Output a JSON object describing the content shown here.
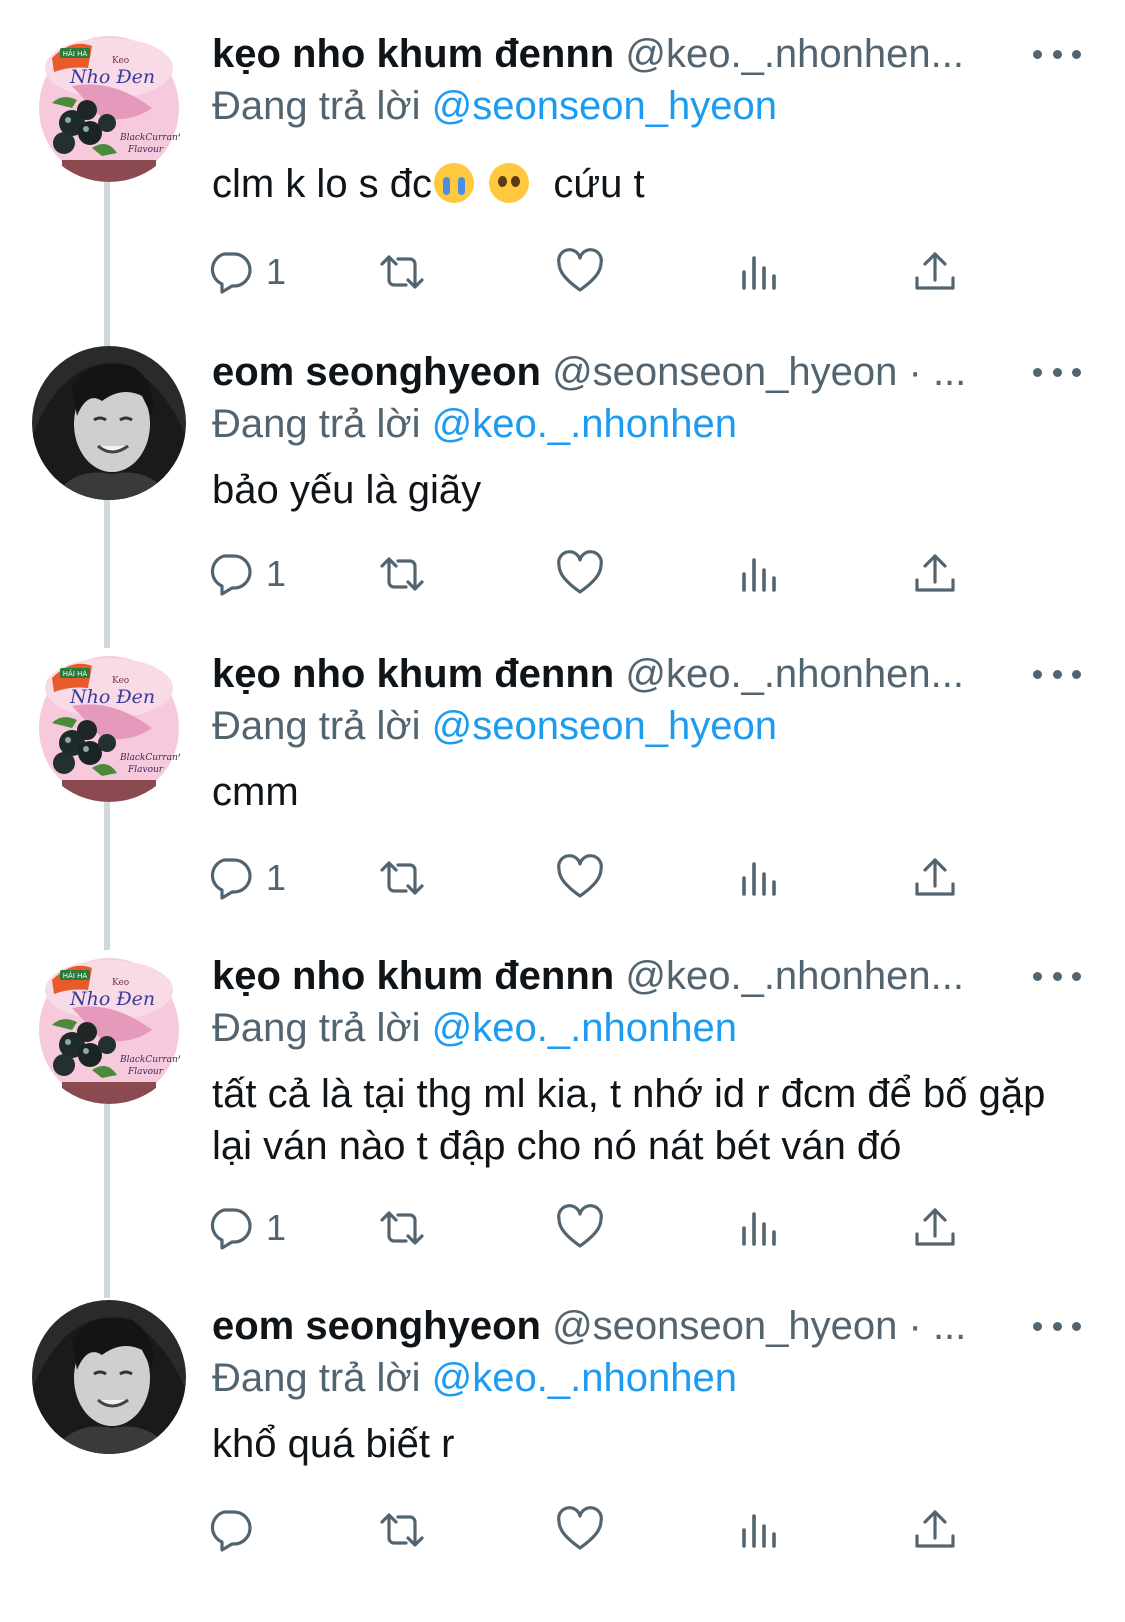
{
  "tweets": [
    {
      "name": "kẹo nho khum đennn",
      "handle": "@keo._.nhonhen...",
      "reply_prefix": "Đang trả lời",
      "reply_to": "@seonseon_hyeon",
      "text_before": "clm k lo s đc",
      "text_after": "  cứu t",
      "reply_count": "1",
      "avatar": "candy-package-avatar"
    },
    {
      "name": "eom seonghyeon",
      "handle": "@seonseon_hyeon · ...",
      "reply_prefix": "Đang trả lời",
      "reply_to": "@keo._.nhonhen",
      "text": "bảo yếu là giãy",
      "reply_count": "1",
      "avatar": "person-photo-avatar"
    },
    {
      "name": "kẹo nho khum đennn",
      "handle": "@keo._.nhonhen...",
      "reply_prefix": "Đang trả lời",
      "reply_to": "@seonseon_hyeon",
      "text": "cmm",
      "reply_count": "1",
      "avatar": "candy-package-avatar"
    },
    {
      "name": "kẹo nho khum đennn",
      "handle": "@keo._.nhonhen...",
      "reply_prefix": "Đang trả lời",
      "reply_to": "@keo._.nhonhen",
      "text": "tất cả là tại thg ml kia, t nhớ id r đcm để bố gặp lại ván nào t đập cho nó nát bét ván đó",
      "reply_count": "1",
      "avatar": "candy-package-avatar"
    },
    {
      "name": "eom seonghyeon",
      "handle": "@seonseon_hyeon · ...",
      "reply_prefix": "Đang trả lời",
      "reply_to": "@keo._.nhonhen",
      "text": "khổ quá biết r",
      "reply_count": "",
      "avatar": "person-photo-avatar"
    }
  ],
  "candy_avatar": {
    "brand": "HẢI HÀ",
    "product_small": "Keo",
    "product": "Nho Đen",
    "flavour_line1": "BlackCurrant",
    "flavour_line2": "Flavour"
  },
  "colors": {
    "accent": "#1d9bf0",
    "secondary_text": "#536471",
    "thread_line": "#cfd9de"
  }
}
